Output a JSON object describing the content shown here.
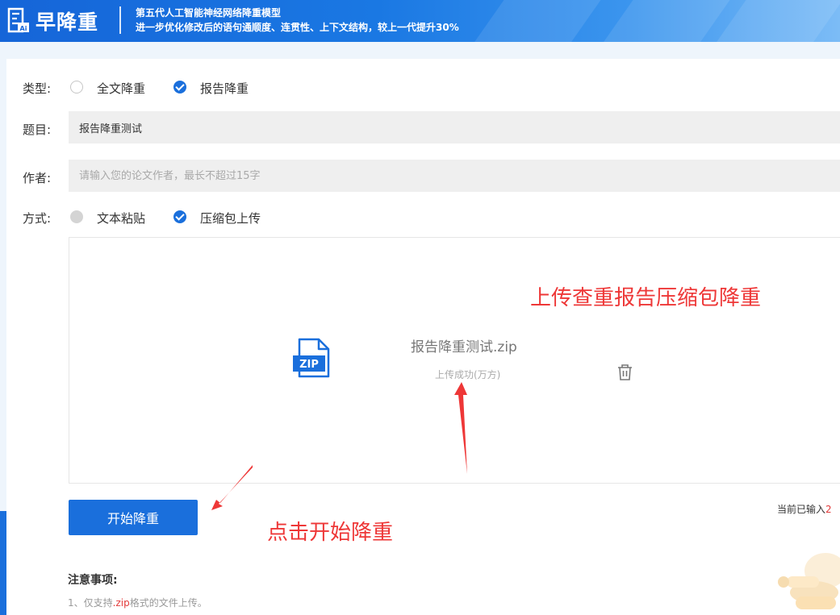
{
  "header": {
    "brand": "早降重",
    "slogan_line1": "第五代人工智能神经网络降重模型",
    "slogan_line2": "进一步优化修改后的语句通顺度、连贯性、上下文结构，较上一代提升30%"
  },
  "form": {
    "type": {
      "label": "类型:",
      "options": [
        {
          "label": "全文降重",
          "checked": false
        },
        {
          "label": "报告降重",
          "checked": true
        }
      ]
    },
    "title": {
      "label": "题目:",
      "value": "报告降重测试"
    },
    "author": {
      "label": "作者:",
      "value": "",
      "placeholder": "请输入您的论文作者，最长不超过15字"
    },
    "method": {
      "label": "方式:",
      "options": [
        {
          "label": "文本粘贴",
          "checked": false
        },
        {
          "label": "压缩包上传",
          "checked": true
        }
      ]
    }
  },
  "upload": {
    "icon_text": "ZIP",
    "file_name": "报告降重测试.zip",
    "status": "上传成功(万方)"
  },
  "annotations": {
    "upload_hint": "上传查重报告压缩包降重",
    "start_hint": "点击开始降重"
  },
  "start_button": {
    "label": "开始降重"
  },
  "input_count": {
    "prefix": "当前已输入",
    "value": "2"
  },
  "notes": {
    "title": "注意事项:",
    "item1_prefix": "1、仅支持",
    "item1_highlight": ".zip",
    "item1_suffix": "格式的文件上传。"
  },
  "colors": {
    "primary": "#1a6fdc",
    "annotation": "#ee3737",
    "highlight": "#e23b3b"
  }
}
